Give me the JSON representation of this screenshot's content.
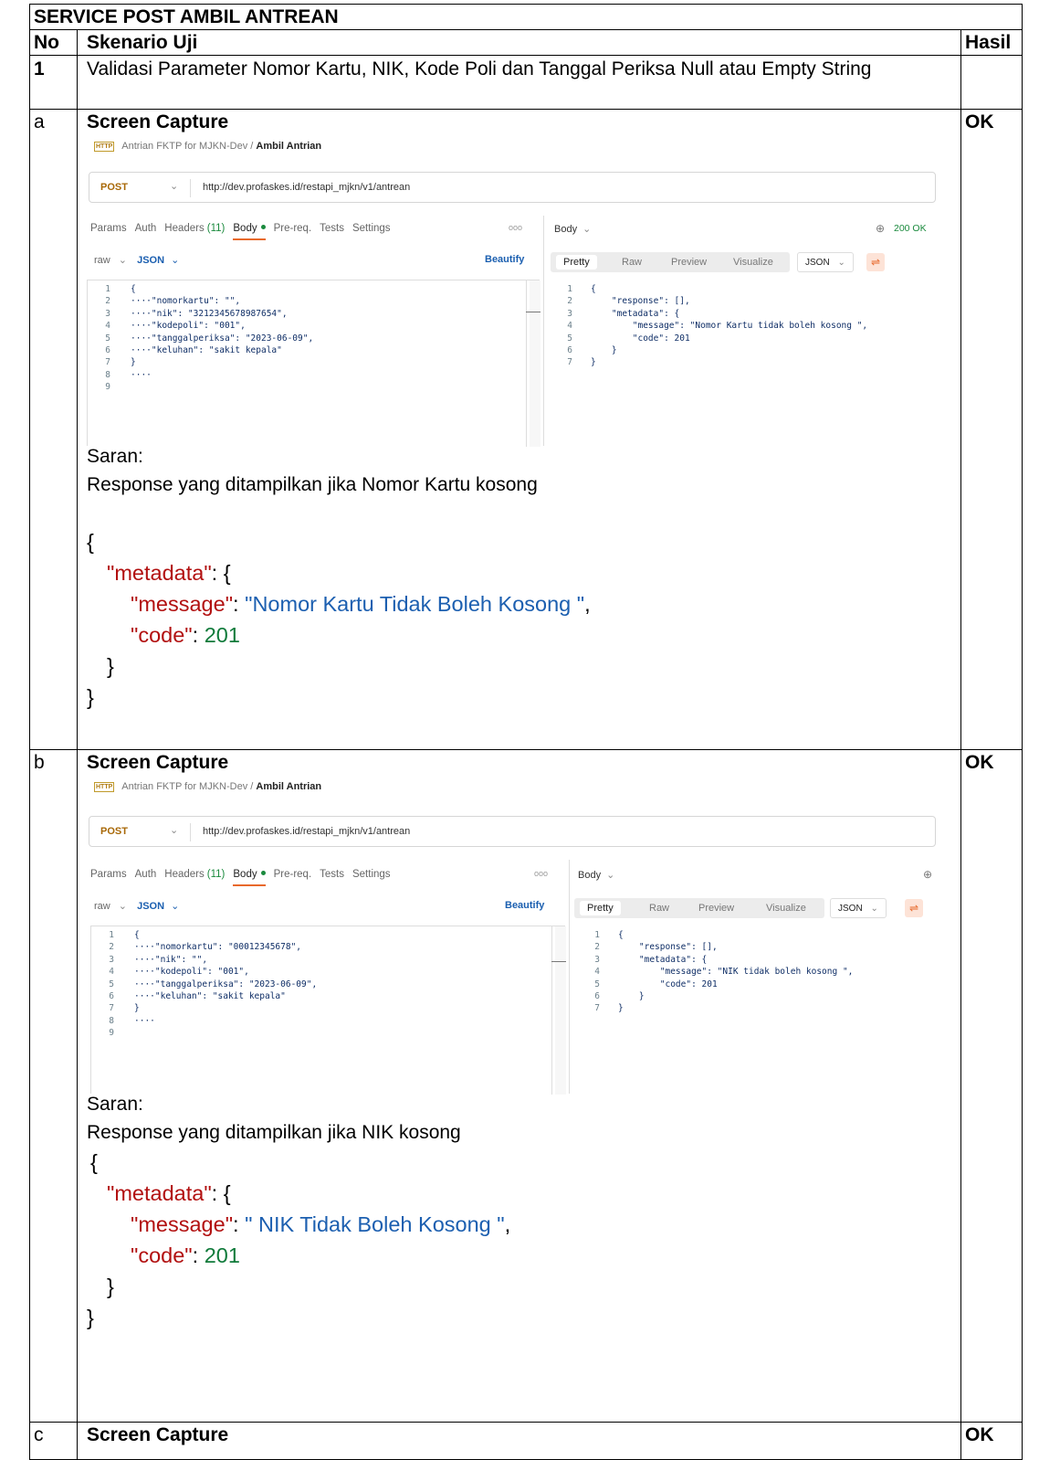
{
  "document": {
    "section_title": "SERVICE POST AMBIL ANTREAN",
    "header": {
      "no": "No",
      "scenario": "Skenario Uji",
      "result": "Hasil"
    },
    "test_case": {
      "no": "1",
      "description": "Validasi Parameter Nomor Kartu, NIK, Kode Poli dan Tanggal Periksa Null atau Empty String"
    },
    "rows": [
      {
        "id": "a",
        "heading": "Screen Capture",
        "result": "OK",
        "screenshot": {
          "breadcrumb_collection": "Antrian FKTP for MJKN-Dev",
          "breadcrumb_sep": "/",
          "breadcrumb_request": "Ambil Antrian",
          "method": "POST",
          "url": "http://dev.profaskes.id/restapi_mjkn/v1/antrean",
          "tabs": [
            "Params",
            "Auth",
            "Headers",
            "(11)",
            "Body",
            "Pre-req.",
            "Tests",
            "Settings"
          ],
          "more": "ooo",
          "body_mode": "raw",
          "body_lang": "JSON",
          "beautify": "Beautify",
          "response_label": "Body",
          "status": "200 OK",
          "resp_tabs": [
            "Pretty",
            "Raw",
            "Preview",
            "Visualize"
          ],
          "resp_lang": "JSON",
          "request_lines": [
            "",
            "{",
            "····\"nomorkartu\": \"\",",
            "····\"nik\": \"3212345678987654\",",
            "····\"kodepoli\": \"001\",",
            "····\"tanggalperiksa\": \"2023-06-09\",",
            "····\"keluhan\": \"sakit kepala\"",
            "}",
            "····"
          ],
          "response_lines": [
            "{",
            "    \"response\": [],",
            "    \"metadata\": {",
            "        \"message\": \"Nomor Kartu tidak boleh kosong \",",
            "        \"code\": 201",
            "    }",
            "}"
          ]
        },
        "saran_label": "Saran:",
        "saran_text": "Response yang ditampilkan jika Nomor Kartu kosong",
        "json": {
          "open": "{",
          "metadata_key": "\"metadata\"",
          "message_key": "\"message\"",
          "message_val": "\"Nomor Kartu Tidak Boleh Kosong \"",
          "code_key": "\"code\"",
          "code_val": "201",
          "inner_close": "}",
          "close": "}"
        }
      },
      {
        "id": "b",
        "heading": "Screen Capture",
        "result": "OK",
        "screenshot": {
          "breadcrumb_collection": "Antrian FKTP for MJKN-Dev",
          "breadcrumb_sep": "/",
          "breadcrumb_request": "Ambil Antrian",
          "method": "POST",
          "url": "http://dev.profaskes.id/restapi_mjkn/v1/antrean",
          "tabs": [
            "Params",
            "Auth",
            "Headers",
            "(11)",
            "Body",
            "Pre-req.",
            "Tests",
            "Settings"
          ],
          "more": "ooo",
          "body_mode": "raw",
          "body_lang": "JSON",
          "beautify": "Beautify",
          "response_label": "Body",
          "status": "",
          "resp_tabs": [
            "Pretty",
            "Raw",
            "Preview",
            "Visualize"
          ],
          "resp_lang": "JSON",
          "request_lines": [
            "",
            "{",
            "····\"nomorkartu\": \"00012345678\",",
            "····\"nik\": \"\",",
            "····\"kodepoli\": \"001\",",
            "····\"tanggalperiksa\": \"2023-06-09\",",
            "····\"keluhan\": \"sakit kepala\"",
            "}",
            "····"
          ],
          "response_lines": [
            "{",
            "    \"response\": [],",
            "    \"metadata\": {",
            "        \"message\": \"NIK tidak boleh kosong \",",
            "        \"code\": 201",
            "    }",
            "}"
          ]
        },
        "saran_label": "Saran:",
        "saran_text": "Response yang ditampilkan jika NIK kosong",
        "json": {
          "open": "{",
          "metadata_key": "\"metadata\"",
          "message_key": "\"message\"",
          "message_val": "\" NIK Tidak Boleh Kosong \"",
          "code_key": "\"code\"",
          "code_val": "201",
          "inner_close": "}",
          "close": "}"
        }
      },
      {
        "id": "c",
        "heading": "Screen Capture",
        "result": "OK"
      }
    ]
  }
}
